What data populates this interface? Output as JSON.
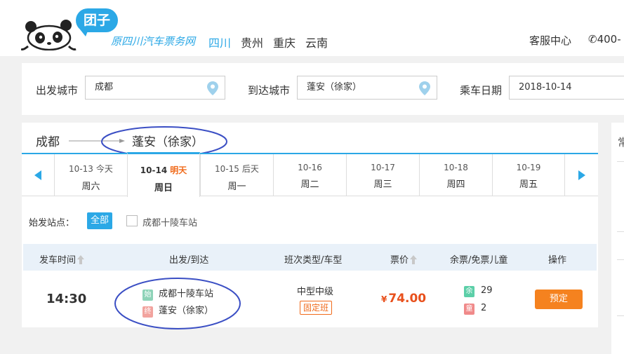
{
  "header": {
    "logo_text": "团子",
    "tagline": "原四川汽车票务网",
    "provinces": [
      "四川",
      "贵州",
      "重庆",
      "云南"
    ],
    "active_province": 0,
    "service_center": "客服中心",
    "phone_partial": "✆400-"
  },
  "search": {
    "from_label": "出发城市",
    "from_value": "成都",
    "to_label": "到达城市",
    "to_value": "蓬安（徐家）",
    "date_label": "乘车日期",
    "date_value": "2018-10-14"
  },
  "route": {
    "from": "成都",
    "to": "蓬安（徐家）"
  },
  "dates": [
    {
      "date": "10-13",
      "rel": "今天",
      "week": "周六"
    },
    {
      "date": "10-14",
      "rel": "明天",
      "week": "周日"
    },
    {
      "date": "10-15",
      "rel": "后天",
      "week": "周一"
    },
    {
      "date": "10-16",
      "rel": "",
      "week": "周二"
    },
    {
      "date": "10-17",
      "rel": "",
      "week": "周三"
    },
    {
      "date": "10-18",
      "rel": "",
      "week": "周四"
    },
    {
      "date": "10-19",
      "rel": "",
      "week": "周五"
    }
  ],
  "active_date_index": 1,
  "station_filter": {
    "label": "始发站点：",
    "all": "全部",
    "station": "成都十陵车站"
  },
  "table": {
    "headers": {
      "depart_time": "发车时间",
      "from_to": "出发/到达",
      "bus_type": "班次类型/车型",
      "price": "票价",
      "seats": "余票/免票儿童",
      "action": "操作"
    },
    "rows": [
      {
        "time": "14:30",
        "start_tag": "始",
        "start_station": "成都十陵车站",
        "end_tag": "终",
        "end_station": "蓬安（徐家）",
        "bus_type": "中型中级",
        "schedule_type": "固定班",
        "currency": "¥",
        "price": "74.00",
        "remaining_tag": "余",
        "remaining": "29",
        "child_tag": "童",
        "child_free": "2",
        "action": "预定"
      }
    ]
  },
  "sidebar": {
    "partial_text": "常"
  },
  "colors": {
    "accent": "#2ba8e6",
    "price": "#e8501c",
    "book_button": "#f5821f",
    "annotation": "#3b4fc4"
  }
}
